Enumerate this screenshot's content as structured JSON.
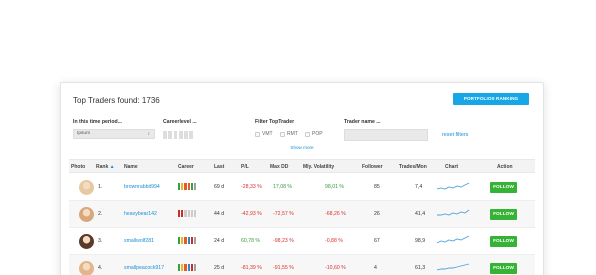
{
  "header": {
    "title": "Top Traders found: 1736",
    "portfolio_button": "PORTFOLIOS RANKING LIST"
  },
  "filters": {
    "time_label": "In this time period...",
    "time_value": "Ipsum",
    "career_label": "Careerlevel ...",
    "toptrader_label": "Filter TopTrader",
    "options": [
      "VMT",
      "RMT",
      "POP"
    ],
    "name_label": "Trader name ...",
    "name_placeholder": "",
    "reset": "reset filters",
    "show_more": "Show more"
  },
  "table": {
    "columns": [
      "Photo",
      "Rank",
      "Name",
      "Career",
      "Last",
      "P/L",
      "Max DD",
      "Mly. Volatility",
      "Follower",
      "Trades/Mon",
      "Chart",
      "Action"
    ],
    "sort_icon": "sort-up-icon",
    "rows": [
      {
        "rank": "1.",
        "name": "brownrabbit994",
        "last": "69 d",
        "pl": "-28,33 %",
        "pl_color": "#d9302f",
        "maxdd": "17,08 %",
        "maxdd_color": "#3a9c3a",
        "vol": "98,01 %",
        "vol_color": "#3a9c3a",
        "follower": "85",
        "trades": "7,4",
        "action": "FOLLOW",
        "avatar_color": "#e7c8a0",
        "career": [
          "#2fa34a",
          "#f0b41c",
          "#e35b2b",
          "#e35b2b",
          "#2fa34a",
          "#a0a0a0"
        ]
      },
      {
        "rank": "2.",
        "name": "heavybear142",
        "last": "44 d",
        "pl": "-42,93 %",
        "pl_color": "#d9302f",
        "maxdd": "-72,57 %",
        "maxdd_color": "#d9302f",
        "vol": "-68,26 %",
        "vol_color": "#d9302f",
        "follower": "26",
        "trades": "41,4",
        "action": "FOLLOW",
        "avatar_color": "#d9a77a",
        "career": [
          "#c9302c",
          "#c9302c",
          "#cccccc",
          "#cccccc",
          "#cccccc",
          "#cccccc"
        ]
      },
      {
        "rank": "3.",
        "name": "smallwolf281",
        "last": "24 d",
        "pl": "60,78 %",
        "pl_color": "#3a9c3a",
        "maxdd": "-98,23 %",
        "maxdd_color": "#d9302f",
        "vol": "-0,88 %",
        "vol_color": "#d9302f",
        "follower": "67",
        "trades": "98,9",
        "action": "FOLLOW",
        "avatar_color": "#5b3a2a",
        "career": [
          "#2fa34a",
          "#f0b41c",
          "#e35b2b",
          "#2f86c8",
          "#c9302c",
          "#a0a0a0"
        ]
      },
      {
        "rank": "4.",
        "name": "smallpeacock917",
        "last": "25 d",
        "pl": "-81,39 %",
        "pl_color": "#d9302f",
        "maxdd": "-91,55 %",
        "maxdd_color": "#d9302f",
        "vol": "-10,60 %",
        "vol_color": "#d9302f",
        "follower": "4",
        "trades": "61,3",
        "action": "FOLLOW",
        "avatar_color": "#e2b58a",
        "career": [
          "#2fa34a",
          "#f0b41c",
          "#e35b2b",
          "#2f86c8",
          "#c9302c",
          "#a0a0a0"
        ]
      }
    ]
  }
}
